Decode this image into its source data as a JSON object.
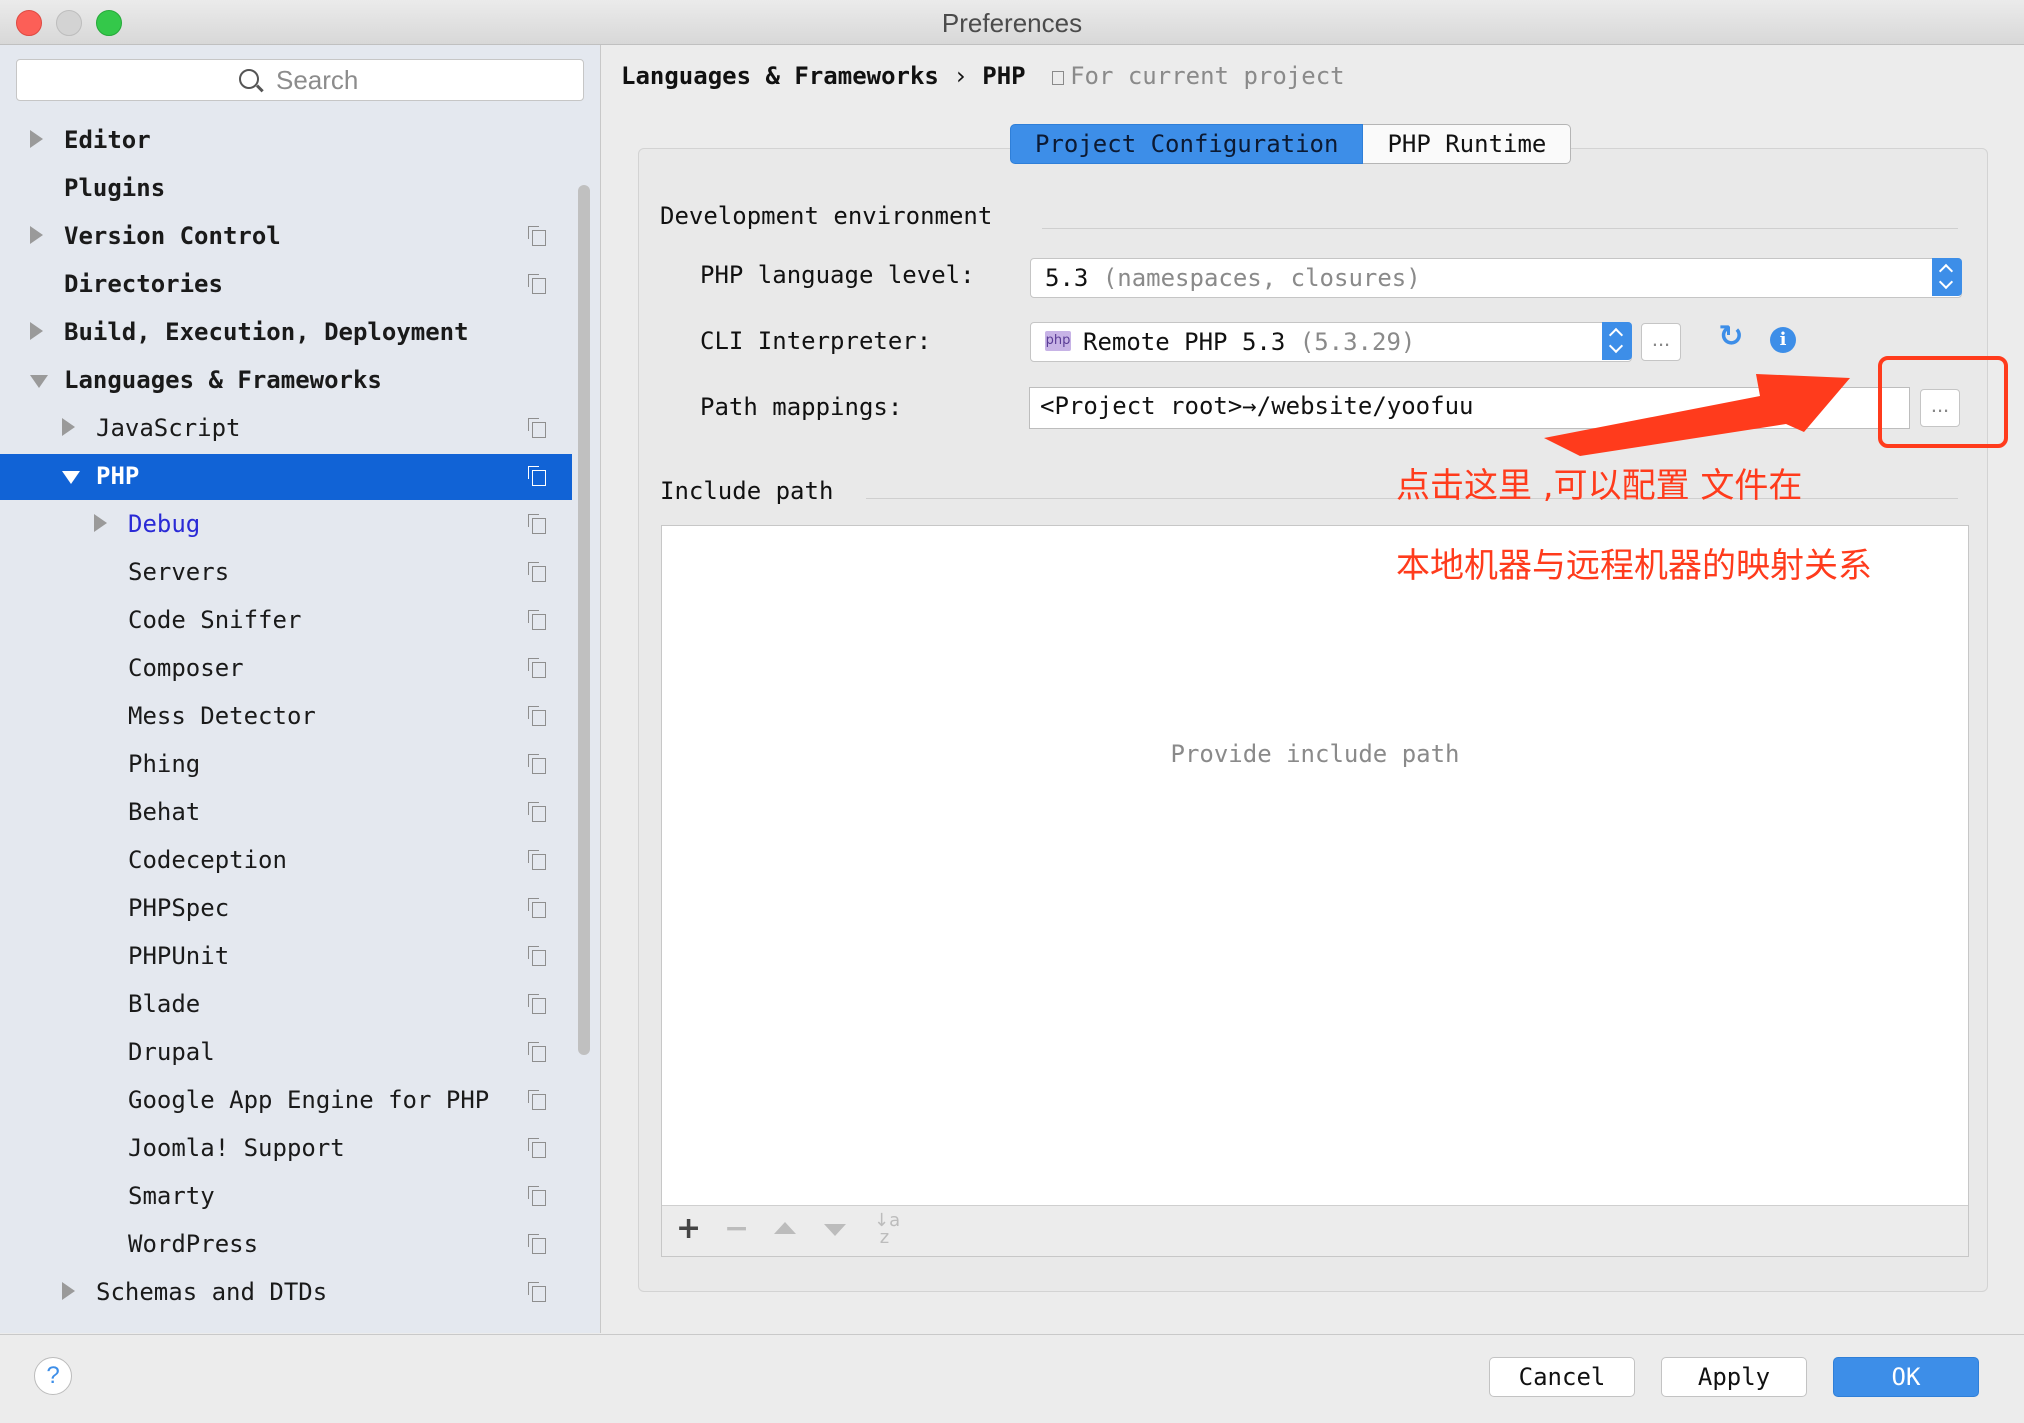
{
  "window": {
    "title": "Preferences"
  },
  "search": {
    "placeholder": "Search"
  },
  "tree": [
    {
      "label": "Editor",
      "bold": true,
      "arrow": "right",
      "copy": false,
      "indent": 0
    },
    {
      "label": "Plugins",
      "bold": true,
      "arrow": "",
      "copy": false,
      "indent": 0
    },
    {
      "label": "Version Control",
      "bold": true,
      "arrow": "right",
      "copy": true,
      "indent": 0
    },
    {
      "label": "Directories",
      "bold": true,
      "arrow": "",
      "copy": true,
      "indent": 0
    },
    {
      "label": "Build, Execution, Deployment",
      "bold": true,
      "arrow": "right",
      "copy": false,
      "indent": 0
    },
    {
      "label": "Languages & Frameworks",
      "bold": true,
      "arrow": "down",
      "copy": false,
      "indent": 0
    },
    {
      "label": "JavaScript",
      "bold": false,
      "arrow": "right",
      "copy": true,
      "indent": 1
    },
    {
      "label": "PHP",
      "bold": true,
      "arrow": "down",
      "copy": true,
      "indent": 1,
      "selected": true
    },
    {
      "label": "Debug",
      "bold": false,
      "arrow": "right",
      "copy": true,
      "indent": 2,
      "link": true
    },
    {
      "label": "Servers",
      "bold": false,
      "arrow": "",
      "copy": true,
      "indent": 2
    },
    {
      "label": "Code Sniffer",
      "bold": false,
      "arrow": "",
      "copy": true,
      "indent": 2
    },
    {
      "label": "Composer",
      "bold": false,
      "arrow": "",
      "copy": true,
      "indent": 2
    },
    {
      "label": "Mess Detector",
      "bold": false,
      "arrow": "",
      "copy": true,
      "indent": 2
    },
    {
      "label": "Phing",
      "bold": false,
      "arrow": "",
      "copy": true,
      "indent": 2
    },
    {
      "label": "Behat",
      "bold": false,
      "arrow": "",
      "copy": true,
      "indent": 2
    },
    {
      "label": "Codeception",
      "bold": false,
      "arrow": "",
      "copy": true,
      "indent": 2
    },
    {
      "label": "PHPSpec",
      "bold": false,
      "arrow": "",
      "copy": true,
      "indent": 2
    },
    {
      "label": "PHPUnit",
      "bold": false,
      "arrow": "",
      "copy": true,
      "indent": 2
    },
    {
      "label": "Blade",
      "bold": false,
      "arrow": "",
      "copy": true,
      "indent": 2
    },
    {
      "label": "Drupal",
      "bold": false,
      "arrow": "",
      "copy": true,
      "indent": 2
    },
    {
      "label": "Google App Engine for PHP",
      "bold": false,
      "arrow": "",
      "copy": true,
      "indent": 2,
      "clip": true
    },
    {
      "label": "Joomla! Support",
      "bold": false,
      "arrow": "",
      "copy": true,
      "indent": 2
    },
    {
      "label": "Smarty",
      "bold": false,
      "arrow": "",
      "copy": true,
      "indent": 2
    },
    {
      "label": "WordPress",
      "bold": false,
      "arrow": "",
      "copy": true,
      "indent": 2
    },
    {
      "label": "Schemas and DTDs",
      "bold": false,
      "arrow": "right",
      "copy": true,
      "indent": 1
    }
  ],
  "breadcrumb": {
    "part1": "Languages & Frameworks",
    "sep": "›",
    "part2": "PHP",
    "scope": "For current project"
  },
  "tabs": {
    "active": "Project Configuration",
    "inactive": "PHP Runtime"
  },
  "dev_env": {
    "header": "Development environment",
    "language_level_label": "PHP language level:",
    "language_level_value": "5.3",
    "language_level_hint": "(namespaces, closures)",
    "cli_label": "CLI Interpreter:",
    "cli_value": "Remote PHP 5.3",
    "cli_version": "(5.3.29)",
    "cli_icon": "php",
    "cli_more": "...",
    "path_label": "Path mappings:",
    "path_value": "<Project root>→/website/yoofuu",
    "path_more": "..."
  },
  "include": {
    "header": "Include path",
    "empty_text": "Provide include path"
  },
  "annotation": {
    "line1": "点击这里 ,可以配置 文件在",
    "line2": "本地机器与远程机器的映射关系",
    "color": "#ff3b1c"
  },
  "footer": {
    "help": "?",
    "cancel": "Cancel",
    "apply": "Apply",
    "ok": "OK"
  },
  "colors": {
    "accent": "#3d8ee8",
    "selection": "#1163d6"
  }
}
